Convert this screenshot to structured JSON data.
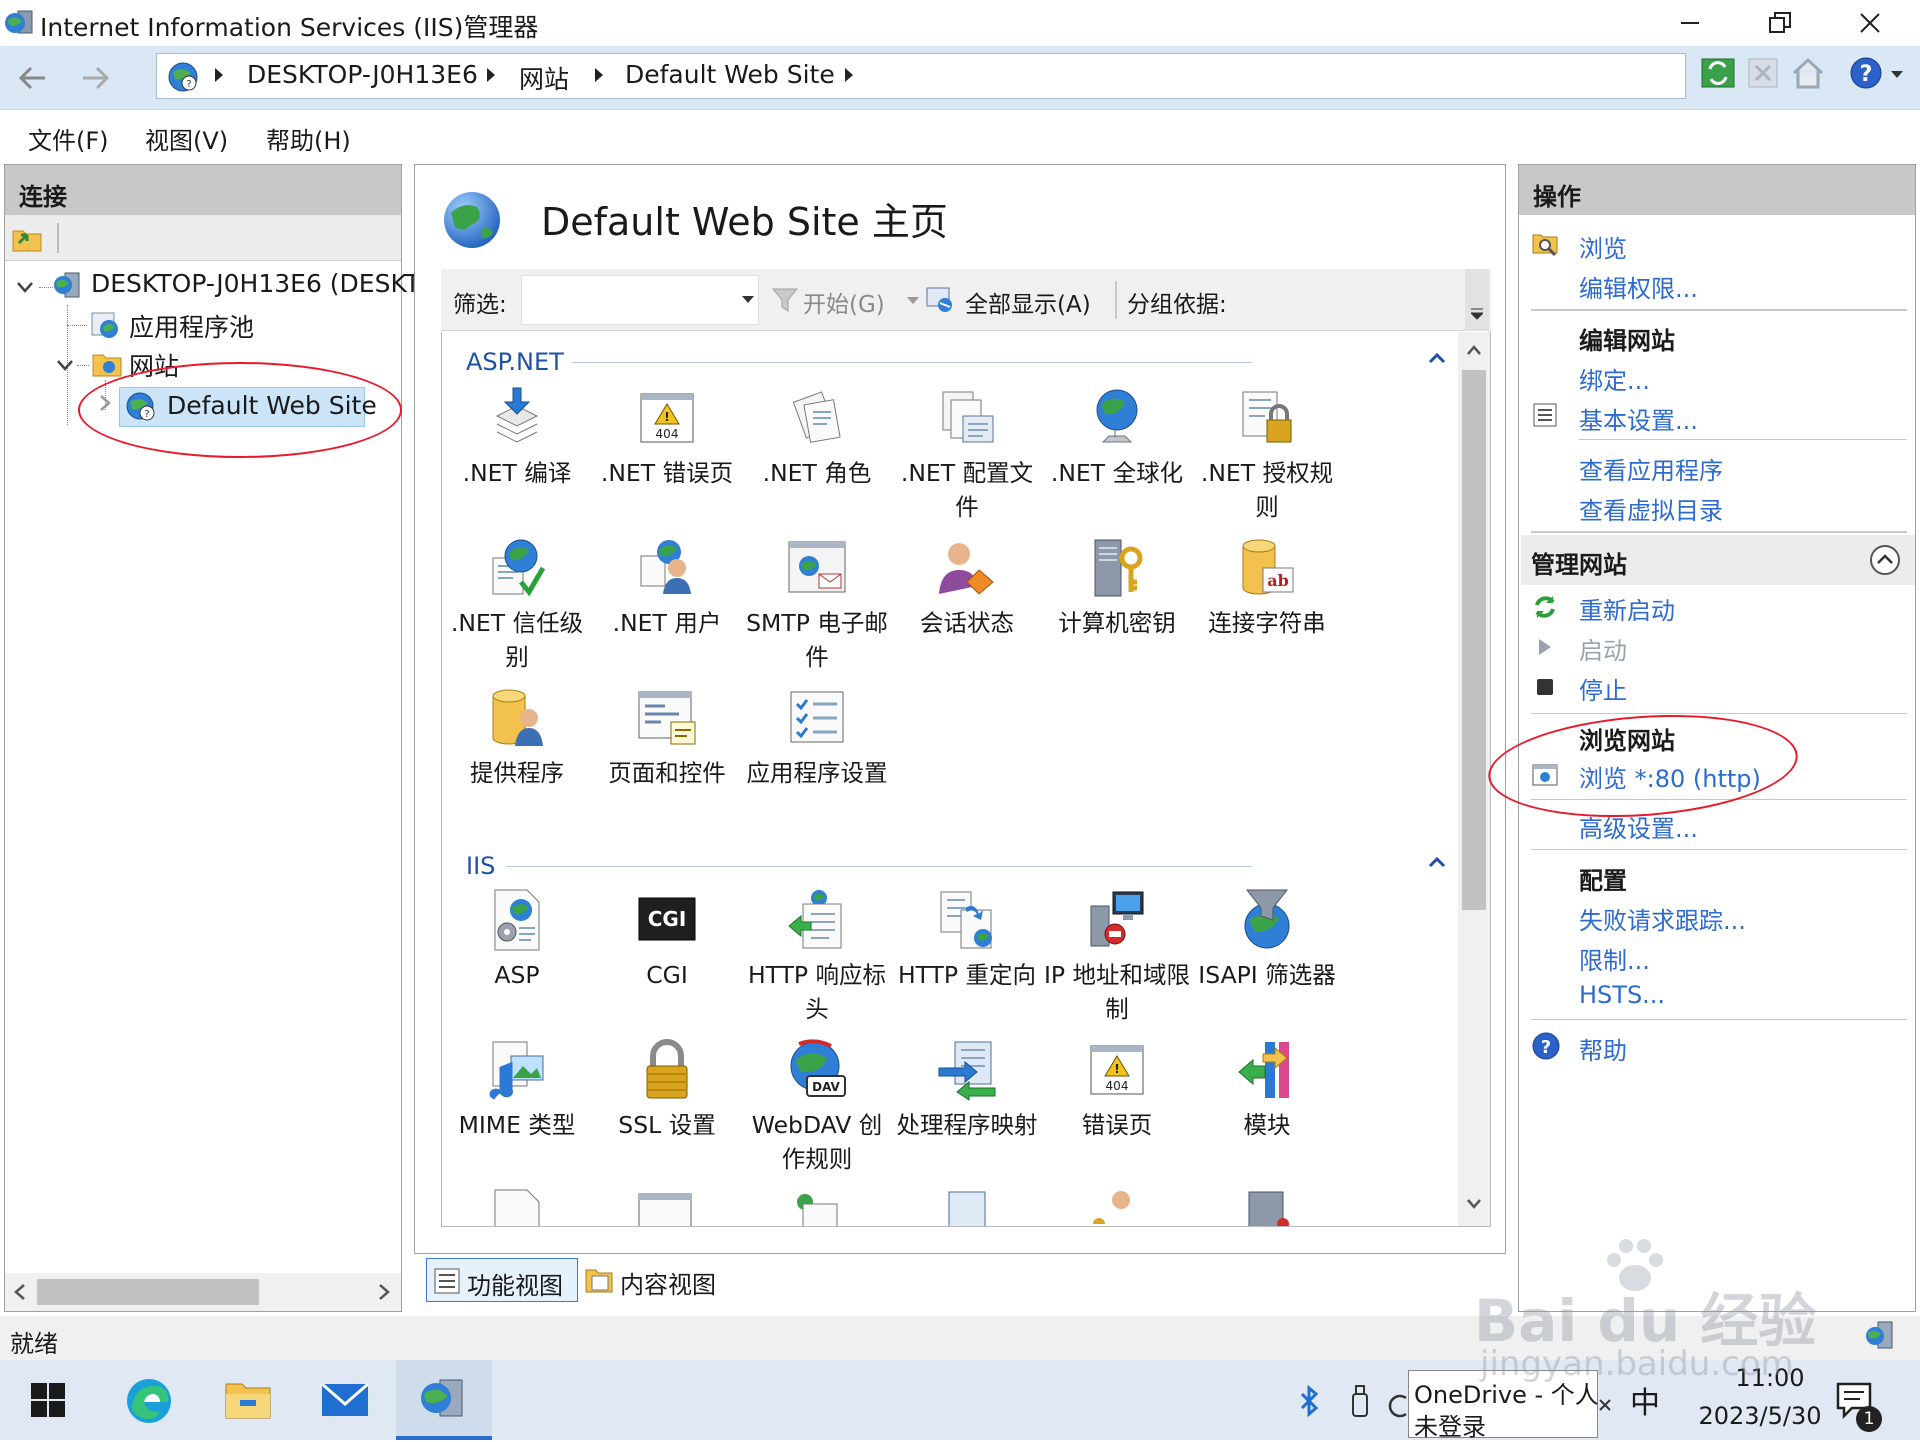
{
  "window": {
    "title": "Internet Information Services (IIS)管理器"
  },
  "address_bar": {
    "crumbs": [
      "DESKTOP-J0H13E6",
      "网站",
      "Default Web Site"
    ]
  },
  "menu": {
    "items": [
      "文件(F)",
      "视图(V)",
      "帮助(H)"
    ]
  },
  "connections": {
    "header": "连接",
    "tree": {
      "server": "DESKTOP-J0H13E6 (DESKT",
      "app_pools": "应用程序池",
      "sites": "网站",
      "selected_site": "Default Web Site"
    }
  },
  "main": {
    "title": "Default Web Site 主页",
    "filter": {
      "label": "筛选:",
      "start_label": "开始(G)",
      "show_all_label": "全部显示(A)",
      "group_by_label": "分组依据:"
    },
    "groups": [
      {
        "name": "ASP.NET",
        "features": [
          {
            "label": ".NET 编译",
            "icon": "net-compilation-icon"
          },
          {
            "label": ".NET 错误页",
            "icon": "net-error-pages-icon"
          },
          {
            "label": ".NET 角色",
            "icon": "net-roles-icon"
          },
          {
            "label": ".NET 配置文件",
            "icon": "net-profile-icon"
          },
          {
            "label": ".NET 全球化",
            "icon": "net-globalization-icon"
          },
          {
            "label": ".NET 授权规则",
            "icon": "net-authorization-icon"
          },
          {
            "label": ".NET 信任级别",
            "icon": "net-trust-levels-icon"
          },
          {
            "label": ".NET 用户",
            "icon": "net-users-icon"
          },
          {
            "label": "SMTP 电子邮件",
            "icon": "smtp-email-icon"
          },
          {
            "label": "会话状态",
            "icon": "session-state-icon"
          },
          {
            "label": "计算机密钥",
            "icon": "machine-key-icon"
          },
          {
            "label": "连接字符串",
            "icon": "connection-strings-icon"
          },
          {
            "label": "提供程序",
            "icon": "providers-icon"
          },
          {
            "label": "页面和控件",
            "icon": "pages-controls-icon"
          },
          {
            "label": "应用程序设置",
            "icon": "app-settings-icon"
          }
        ]
      },
      {
        "name": "IIS",
        "features": [
          {
            "label": "ASP",
            "icon": "asp-icon"
          },
          {
            "label": "CGI",
            "icon": "cgi-icon"
          },
          {
            "label": "HTTP 响应标头",
            "icon": "http-response-headers-icon"
          },
          {
            "label": "HTTP 重定向",
            "icon": "http-redirect-icon"
          },
          {
            "label": "IP 地址和域限制",
            "icon": "ip-domain-restrictions-icon"
          },
          {
            "label": "ISAPI 筛选器",
            "icon": "isapi-filters-icon"
          },
          {
            "label": "MIME 类型",
            "icon": "mime-types-icon"
          },
          {
            "label": "SSL 设置",
            "icon": "ssl-settings-icon"
          },
          {
            "label": "WebDAV 创作规则",
            "icon": "webdav-icon"
          },
          {
            "label": "处理程序映射",
            "icon": "handler-mappings-icon"
          },
          {
            "label": "错误页",
            "icon": "error-pages-icon"
          },
          {
            "label": "模块",
            "icon": "modules-icon"
          }
        ]
      }
    ],
    "view_tabs": [
      "功能视图",
      "内容视图"
    ]
  },
  "actions": {
    "header": "操作",
    "explore": "浏览",
    "edit_permissions": "编辑权限...",
    "edit_site_header": "编辑网站",
    "bindings": "绑定...",
    "basic_settings": "基本设置...",
    "view_applications": "查看应用程序",
    "view_virtual_dirs": "查看虚拟目录",
    "manage_site_header": "管理网站",
    "restart": "重新启动",
    "start": "启动",
    "stop": "停止",
    "browse_site_header": "浏览网站",
    "browse_80": "浏览 *:80 (http)",
    "advanced_settings": "高级设置...",
    "configure_header": "配置",
    "failed_request_tracing": "失败请求跟踪...",
    "limits": "限制...",
    "hsts": "HSTS...",
    "help": "帮助"
  },
  "status_bar": {
    "text": "就绪"
  },
  "taskbar": {
    "onedrive_line1": "OneDrive - 个人",
    "onedrive_line2": "未登录",
    "ime": "中",
    "time": "11:00",
    "date": "2023/5/30",
    "notification_count": "1"
  },
  "watermark": {
    "brand": "Bai du 经验",
    "url": "jingyan.baidu.com"
  },
  "colors": {
    "accent_link": "#2d6bd0",
    "group_header": "#1e52a6",
    "annotation_red": "#e8192c",
    "address_bar_bg": "#dae7f5"
  }
}
